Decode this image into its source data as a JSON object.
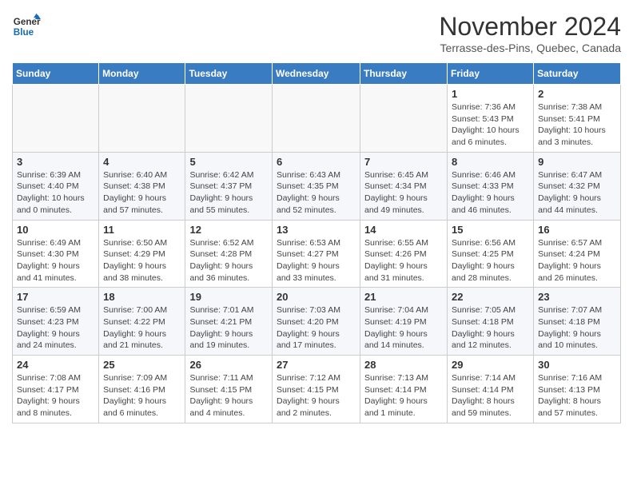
{
  "logo": {
    "line1": "General",
    "line2": "Blue"
  },
  "title": "November 2024",
  "subtitle": "Terrasse-des-Pins, Quebec, Canada",
  "weekdays": [
    "Sunday",
    "Monday",
    "Tuesday",
    "Wednesday",
    "Thursday",
    "Friday",
    "Saturday"
  ],
  "weeks": [
    [
      {
        "day": "",
        "info": ""
      },
      {
        "day": "",
        "info": ""
      },
      {
        "day": "",
        "info": ""
      },
      {
        "day": "",
        "info": ""
      },
      {
        "day": "",
        "info": ""
      },
      {
        "day": "1",
        "info": "Sunrise: 7:36 AM\nSunset: 5:43 PM\nDaylight: 10 hours and 6 minutes."
      },
      {
        "day": "2",
        "info": "Sunrise: 7:38 AM\nSunset: 5:41 PM\nDaylight: 10 hours and 3 minutes."
      }
    ],
    [
      {
        "day": "3",
        "info": "Sunrise: 6:39 AM\nSunset: 4:40 PM\nDaylight: 10 hours and 0 minutes."
      },
      {
        "day": "4",
        "info": "Sunrise: 6:40 AM\nSunset: 4:38 PM\nDaylight: 9 hours and 57 minutes."
      },
      {
        "day": "5",
        "info": "Sunrise: 6:42 AM\nSunset: 4:37 PM\nDaylight: 9 hours and 55 minutes."
      },
      {
        "day": "6",
        "info": "Sunrise: 6:43 AM\nSunset: 4:35 PM\nDaylight: 9 hours and 52 minutes."
      },
      {
        "day": "7",
        "info": "Sunrise: 6:45 AM\nSunset: 4:34 PM\nDaylight: 9 hours and 49 minutes."
      },
      {
        "day": "8",
        "info": "Sunrise: 6:46 AM\nSunset: 4:33 PM\nDaylight: 9 hours and 46 minutes."
      },
      {
        "day": "9",
        "info": "Sunrise: 6:47 AM\nSunset: 4:32 PM\nDaylight: 9 hours and 44 minutes."
      }
    ],
    [
      {
        "day": "10",
        "info": "Sunrise: 6:49 AM\nSunset: 4:30 PM\nDaylight: 9 hours and 41 minutes."
      },
      {
        "day": "11",
        "info": "Sunrise: 6:50 AM\nSunset: 4:29 PM\nDaylight: 9 hours and 38 minutes."
      },
      {
        "day": "12",
        "info": "Sunrise: 6:52 AM\nSunset: 4:28 PM\nDaylight: 9 hours and 36 minutes."
      },
      {
        "day": "13",
        "info": "Sunrise: 6:53 AM\nSunset: 4:27 PM\nDaylight: 9 hours and 33 minutes."
      },
      {
        "day": "14",
        "info": "Sunrise: 6:55 AM\nSunset: 4:26 PM\nDaylight: 9 hours and 31 minutes."
      },
      {
        "day": "15",
        "info": "Sunrise: 6:56 AM\nSunset: 4:25 PM\nDaylight: 9 hours and 28 minutes."
      },
      {
        "day": "16",
        "info": "Sunrise: 6:57 AM\nSunset: 4:24 PM\nDaylight: 9 hours and 26 minutes."
      }
    ],
    [
      {
        "day": "17",
        "info": "Sunrise: 6:59 AM\nSunset: 4:23 PM\nDaylight: 9 hours and 24 minutes."
      },
      {
        "day": "18",
        "info": "Sunrise: 7:00 AM\nSunset: 4:22 PM\nDaylight: 9 hours and 21 minutes."
      },
      {
        "day": "19",
        "info": "Sunrise: 7:01 AM\nSunset: 4:21 PM\nDaylight: 9 hours and 19 minutes."
      },
      {
        "day": "20",
        "info": "Sunrise: 7:03 AM\nSunset: 4:20 PM\nDaylight: 9 hours and 17 minutes."
      },
      {
        "day": "21",
        "info": "Sunrise: 7:04 AM\nSunset: 4:19 PM\nDaylight: 9 hours and 14 minutes."
      },
      {
        "day": "22",
        "info": "Sunrise: 7:05 AM\nSunset: 4:18 PM\nDaylight: 9 hours and 12 minutes."
      },
      {
        "day": "23",
        "info": "Sunrise: 7:07 AM\nSunset: 4:18 PM\nDaylight: 9 hours and 10 minutes."
      }
    ],
    [
      {
        "day": "24",
        "info": "Sunrise: 7:08 AM\nSunset: 4:17 PM\nDaylight: 9 hours and 8 minutes."
      },
      {
        "day": "25",
        "info": "Sunrise: 7:09 AM\nSunset: 4:16 PM\nDaylight: 9 hours and 6 minutes."
      },
      {
        "day": "26",
        "info": "Sunrise: 7:11 AM\nSunset: 4:15 PM\nDaylight: 9 hours and 4 minutes."
      },
      {
        "day": "27",
        "info": "Sunrise: 7:12 AM\nSunset: 4:15 PM\nDaylight: 9 hours and 2 minutes."
      },
      {
        "day": "28",
        "info": "Sunrise: 7:13 AM\nSunset: 4:14 PM\nDaylight: 9 hours and 1 minute."
      },
      {
        "day": "29",
        "info": "Sunrise: 7:14 AM\nSunset: 4:14 PM\nDaylight: 8 hours and 59 minutes."
      },
      {
        "day": "30",
        "info": "Sunrise: 7:16 AM\nSunset: 4:13 PM\nDaylight: 8 hours and 57 minutes."
      }
    ]
  ]
}
